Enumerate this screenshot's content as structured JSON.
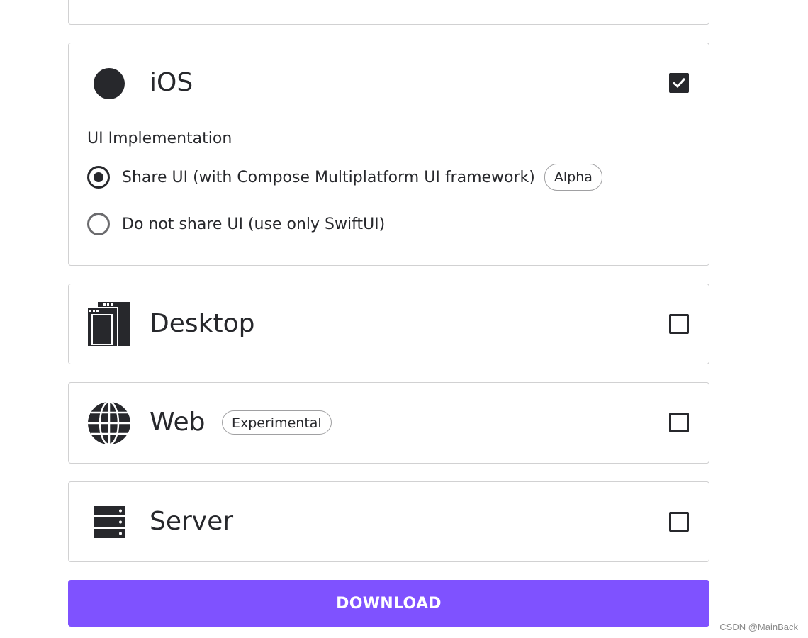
{
  "platforms": {
    "ios": {
      "title": "iOS",
      "icon": "apple-icon",
      "checked": true,
      "ui_implementation": {
        "label": "UI Implementation",
        "options": [
          {
            "label": "Share UI (with Compose Multiplatform UI framework)",
            "badge": "Alpha",
            "selected": true
          },
          {
            "label": "Do not share UI (use only SwiftUI)",
            "selected": false
          }
        ]
      }
    },
    "desktop": {
      "title": "Desktop",
      "icon": "desktop-icon",
      "checked": false
    },
    "web": {
      "title": "Web",
      "icon": "globe-icon",
      "badge": "Experimental",
      "checked": false
    },
    "server": {
      "title": "Server",
      "icon": "server-icon",
      "checked": false
    }
  },
  "download": {
    "label": "DOWNLOAD"
  },
  "watermark": "CSDN @MainBack",
  "colors": {
    "accent": "#7f52ff",
    "text": "#27282c",
    "border": "#d1d1d2"
  }
}
